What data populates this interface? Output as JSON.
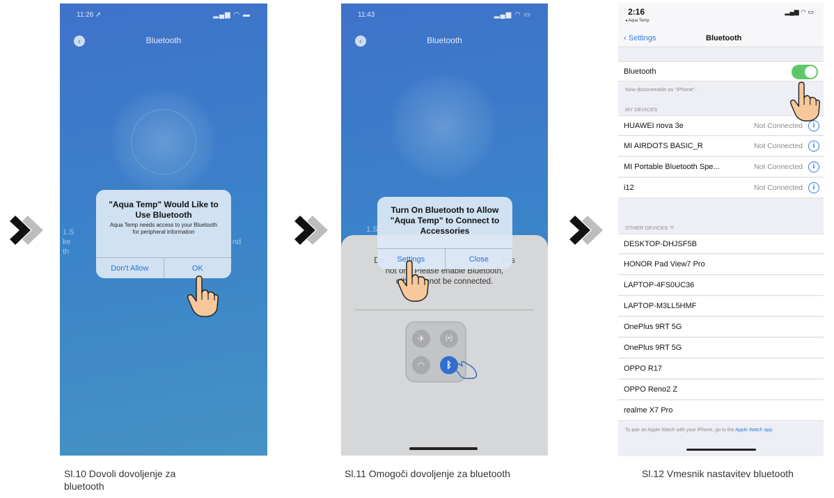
{
  "screen1": {
    "time": "11:26 ➚",
    "status_icons": "▂▄▆ ◠ ▬",
    "title": "Bluetooth",
    "behind_text": [
      "1.S",
      "ke",
      "th"
    ],
    "behind_text_right": "nd",
    "alert": {
      "title": "\"Aqua Temp\" Would Like to Use Bluetooth",
      "message": "Aqua Temp needs access to your Bluetooth for peripheral information",
      "dont_allow": "Don't Allow",
      "ok": "OK"
    }
  },
  "screen2": {
    "time": "11:43",
    "status_icons": "▂▄▆ ◠ ▭",
    "title": "Bluetooth",
    "behind_text": "1.S",
    "alert": {
      "title": "Turn On Bluetooth to Allow \"Aqua Temp\" to Connect to Accessories",
      "settings": "Settings",
      "close": "Close"
    },
    "sheet_text_1": "De",
    "sheet_text_1b": "n is",
    "sheet_text_2": "not on , Please enable Bluetooth,",
    "sheet_text_3": "other cannot be connected."
  },
  "screen3": {
    "time": "2:16",
    "back_app": "◂ Aqua Temp",
    "status_icons": "▂▄▆ ◠ ▭",
    "back_label": "Settings",
    "title": "Bluetooth",
    "bluetooth_label": "Bluetooth",
    "discoverable": "Now discoverable as \"iPhone\".",
    "my_devices_header": "MY DEVICES",
    "my_devices": [
      {
        "name": "HUAWEI nova 3e",
        "status": "Not Connected"
      },
      {
        "name": "MI AIRDOTS BASIC_R",
        "status": "Not Connected"
      },
      {
        "name": "MI Portable Bluetooth Spe...",
        "status": "Not Connected"
      },
      {
        "name": "i12",
        "status": "Not Connected"
      }
    ],
    "other_devices_header": "OTHER DEVICES",
    "other_devices": [
      "DESKTOP-DHJSF5B",
      "HONOR Pad View7 Pro",
      "LAPTOP-4FS0UC36",
      "LAPTOP-M3LL5HMF",
      "OnePlus 9RT 5G",
      "OnePlus 9RT 5G",
      "OPPO R17",
      "OPPO Reno2 Z",
      "realme X7 Pro"
    ],
    "footer_text": "To pair an Apple Watch with your iPhone, go to the ",
    "footer_link": "Apple Watch app."
  },
  "captions": {
    "c1_line1": "Sl.10 Dovoli dovoljenje za",
    "c1_line2": "bluetooth",
    "c2": "Sl.11 Omogoči dovoljenje za bluetooth",
    "c3": "Sl.12 Vmesnik nastavitev bluetooth"
  },
  "colors": {
    "chevron_dark": "#111111",
    "chevron_light": "#bdbdbd",
    "toggle_on": "#5fc76a",
    "link_blue": "#2f7de0",
    "hand_fill": "#f7c89b"
  }
}
